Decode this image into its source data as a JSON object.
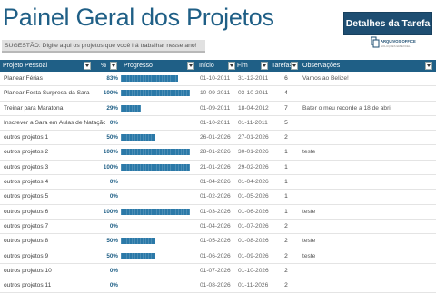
{
  "header": {
    "title": "Painel Geral dos Projetos",
    "details_button": "Detalhes da Tarefa",
    "suggestion": "SUGESTÃO: Digite aqui os projetos que você irá trabalhar nesse ano!",
    "logo_text_1": "ARQUIVOS OFFICE",
    "logo_text_2": "SOLUÇÕES EM EXCEL"
  },
  "columns": {
    "project": "Projeto Pessoal",
    "pct": "%",
    "progress": "Progresso",
    "start": "Início",
    "end": "Fim",
    "tasks": "Tarefas",
    "notes": "Observações"
  },
  "colors": {
    "accent": "#1f5f86",
    "bar": "#2b79a8",
    "button": "#1e4e72"
  },
  "rows": [
    {
      "name": "Planear Férias",
      "pct": "83%",
      "progress": 0.83,
      "start": "01-10-2011",
      "end": "31-12-2011",
      "tasks": "6",
      "notes": "Vamos ao Belize!"
    },
    {
      "name": "Planear Festa Surpresa da Sara",
      "pct": "100%",
      "progress": 1.0,
      "start": "10-09-2011",
      "end": "03-10-2011",
      "tasks": "4",
      "notes": ""
    },
    {
      "name": "Treinar para Maratona",
      "pct": "29%",
      "progress": 0.29,
      "start": "01-09-2011",
      "end": "18-04-2012",
      "tasks": "7",
      "notes": "Bater o meu recorde a 18 de abril"
    },
    {
      "name": "Inscrever a Sara em Aulas de Natação",
      "pct": "0%",
      "progress": 0,
      "start": "01-10-2011",
      "end": "01-11-2011",
      "tasks": "5",
      "notes": ""
    },
    {
      "name": "outros projetos 1",
      "pct": "50%",
      "progress": 0.5,
      "start": "26-01-2026",
      "end": "27-01-2026",
      "tasks": "2",
      "notes": ""
    },
    {
      "name": "outros projetos 2",
      "pct": "100%",
      "progress": 1.0,
      "start": "28-01-2026",
      "end": "30-01-2026",
      "tasks": "1",
      "notes": "teste"
    },
    {
      "name": "outros projetos 3",
      "pct": "100%",
      "progress": 1.0,
      "start": "21-01-2026",
      "end": "29-02-2026",
      "tasks": "1",
      "notes": ""
    },
    {
      "name": "outros projetos 4",
      "pct": "0%",
      "progress": 0,
      "start": "01-04-2026",
      "end": "01-04-2026",
      "tasks": "1",
      "notes": ""
    },
    {
      "name": "outros projetos 5",
      "pct": "0%",
      "progress": 0,
      "start": "01-02-2026",
      "end": "01-05-2026",
      "tasks": "1",
      "notes": ""
    },
    {
      "name": "outros projetos 6",
      "pct": "100%",
      "progress": 1.0,
      "start": "01-03-2026",
      "end": "01-06-2026",
      "tasks": "1",
      "notes": "teste"
    },
    {
      "name": "outros projetos 7",
      "pct": "0%",
      "progress": 0,
      "start": "01-04-2026",
      "end": "01-07-2026",
      "tasks": "2",
      "notes": ""
    },
    {
      "name": "outros projetos 8",
      "pct": "50%",
      "progress": 0.5,
      "start": "01-05-2026",
      "end": "01-08-2026",
      "tasks": "2",
      "notes": "teste"
    },
    {
      "name": "outros projetos 9",
      "pct": "50%",
      "progress": 0.5,
      "start": "01-06-2026",
      "end": "01-09-2026",
      "tasks": "2",
      "notes": "teste"
    },
    {
      "name": "outros projetos 10",
      "pct": "0%",
      "progress": 0,
      "start": "01-07-2026",
      "end": "01-10-2026",
      "tasks": "2",
      "notes": ""
    },
    {
      "name": "outros projetos 11",
      "pct": "0%",
      "progress": 0,
      "start": "01-08-2026",
      "end": "01-11-2026",
      "tasks": "2",
      "notes": ""
    }
  ]
}
